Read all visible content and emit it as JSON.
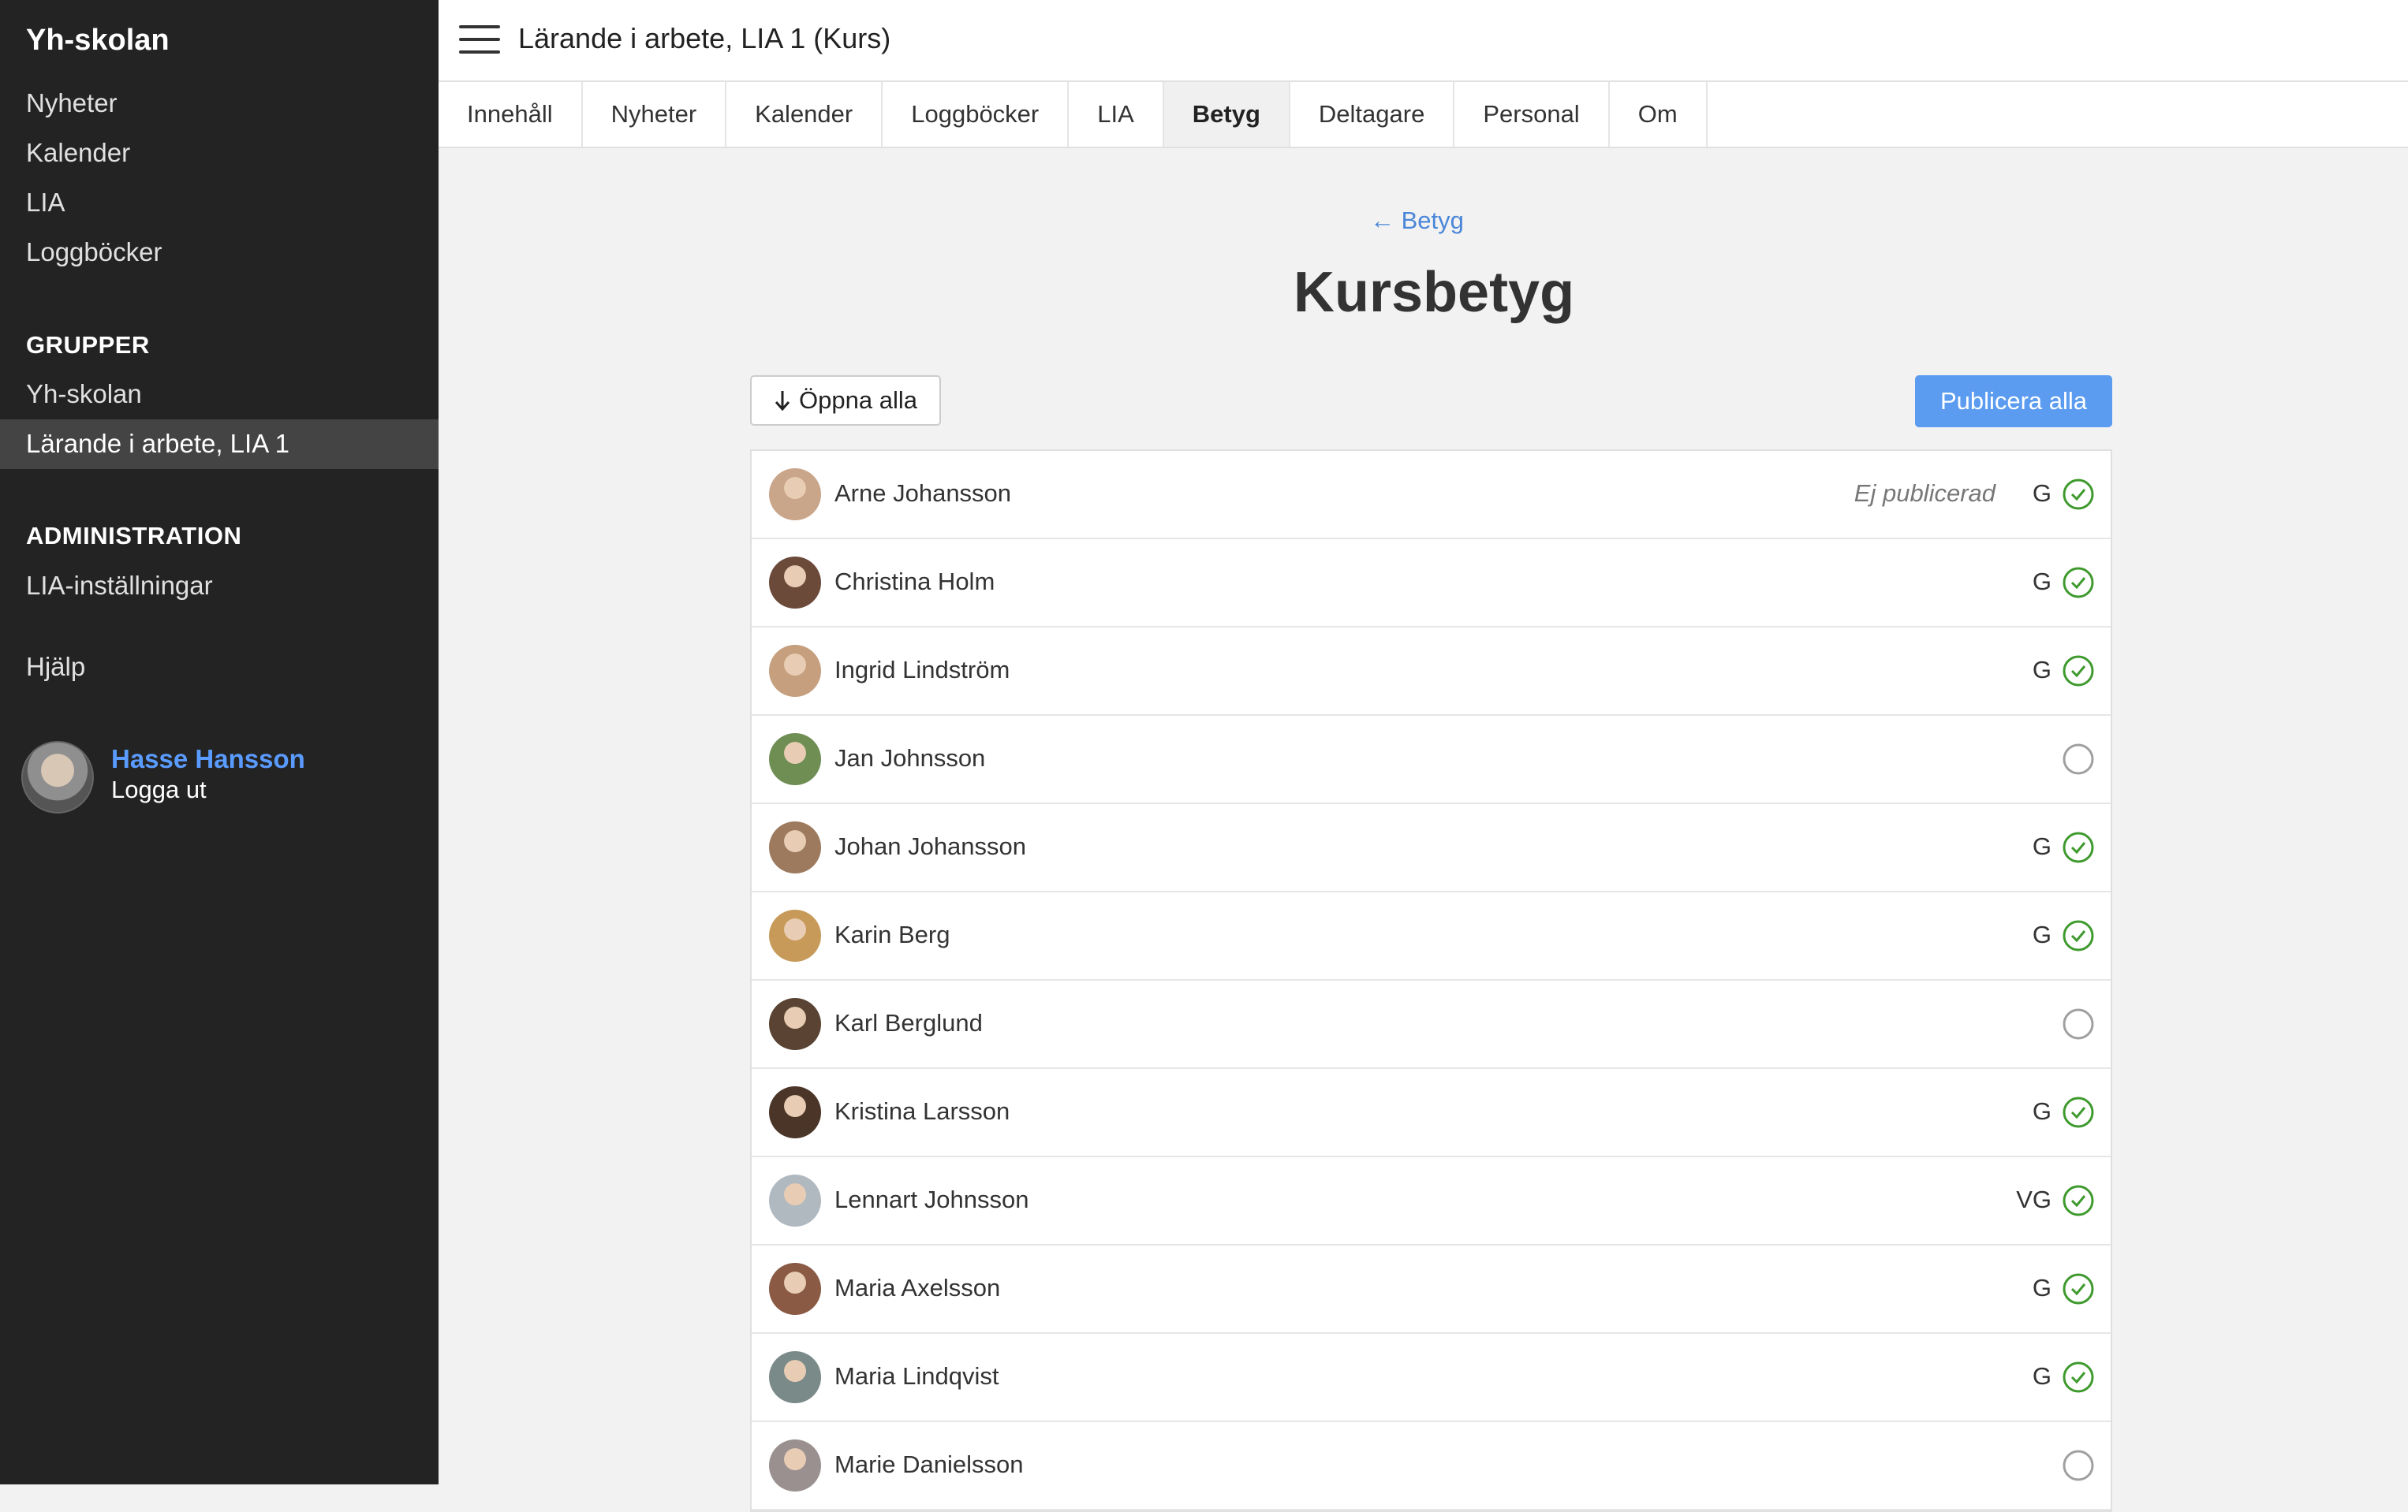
{
  "sidebar": {
    "brand": "Yh-skolan",
    "links": [
      "Nyheter",
      "Kalender",
      "LIA",
      "Loggböcker"
    ],
    "groups_heading": "GRUPPER",
    "groups": [
      "Yh-skolan",
      "Lärande i arbete, LIA 1"
    ],
    "admin_heading": "ADMINISTRATION",
    "admin_links": [
      "LIA-inställningar"
    ],
    "help": "Hjälp",
    "user": {
      "name": "Hasse Hansson",
      "logout": "Logga ut"
    }
  },
  "header": {
    "title": "Lärande i arbete, LIA 1 (Kurs)"
  },
  "tabs": [
    "Innehåll",
    "Nyheter",
    "Kalender",
    "Loggböcker",
    "LIA",
    "Betyg",
    "Deltagare",
    "Personal",
    "Om"
  ],
  "active_tab": "Betyg",
  "content": {
    "back": "← Betyg",
    "title": "Kursbetyg",
    "open_all": "Öppna alla",
    "open_all_icon": "arrow-down-icon",
    "publish_all": "Publicera alla"
  },
  "colors": {
    "accent": "#5b9cf0",
    "link": "#4a86d8",
    "check_green": "#3f9a2e",
    "check_empty": "#a0a0a0",
    "sidebar_bg": "#232323"
  },
  "students": [
    {
      "name": "Arne Johansson",
      "status": "Ej publicerad",
      "grade": "G",
      "graded": true,
      "avatar": "#c9a58a"
    },
    {
      "name": "Christina Holm",
      "status": "",
      "grade": "G",
      "graded": true,
      "avatar": "#6b4a3a"
    },
    {
      "name": "Ingrid Lindström",
      "status": "",
      "grade": "G",
      "graded": true,
      "avatar": "#c6a07e"
    },
    {
      "name": "Jan Johnsson",
      "status": "",
      "grade": "",
      "graded": false,
      "avatar": "#6f8e54"
    },
    {
      "name": "Johan Johansson",
      "status": "",
      "grade": "G",
      "graded": true,
      "avatar": "#9d7a5e"
    },
    {
      "name": "Karin Berg",
      "status": "",
      "grade": "G",
      "graded": true,
      "avatar": "#c79a5a"
    },
    {
      "name": "Karl Berglund",
      "status": "",
      "grade": "",
      "graded": false,
      "avatar": "#5a4332"
    },
    {
      "name": "Kristina Larsson",
      "status": "",
      "grade": "G",
      "graded": true,
      "avatar": "#4a3528"
    },
    {
      "name": "Lennart Johnsson",
      "status": "",
      "grade": "VG",
      "graded": true,
      "avatar": "#b0b8c0"
    },
    {
      "name": "Maria Axelsson",
      "status": "",
      "grade": "G",
      "graded": true,
      "avatar": "#8a5a44"
    },
    {
      "name": "Maria Lindqvist",
      "status": "",
      "grade": "G",
      "graded": true,
      "avatar": "#7a8a88"
    },
    {
      "name": "Marie Danielsson",
      "status": "",
      "grade": "",
      "graded": false,
      "avatar": "#9a9090"
    }
  ]
}
